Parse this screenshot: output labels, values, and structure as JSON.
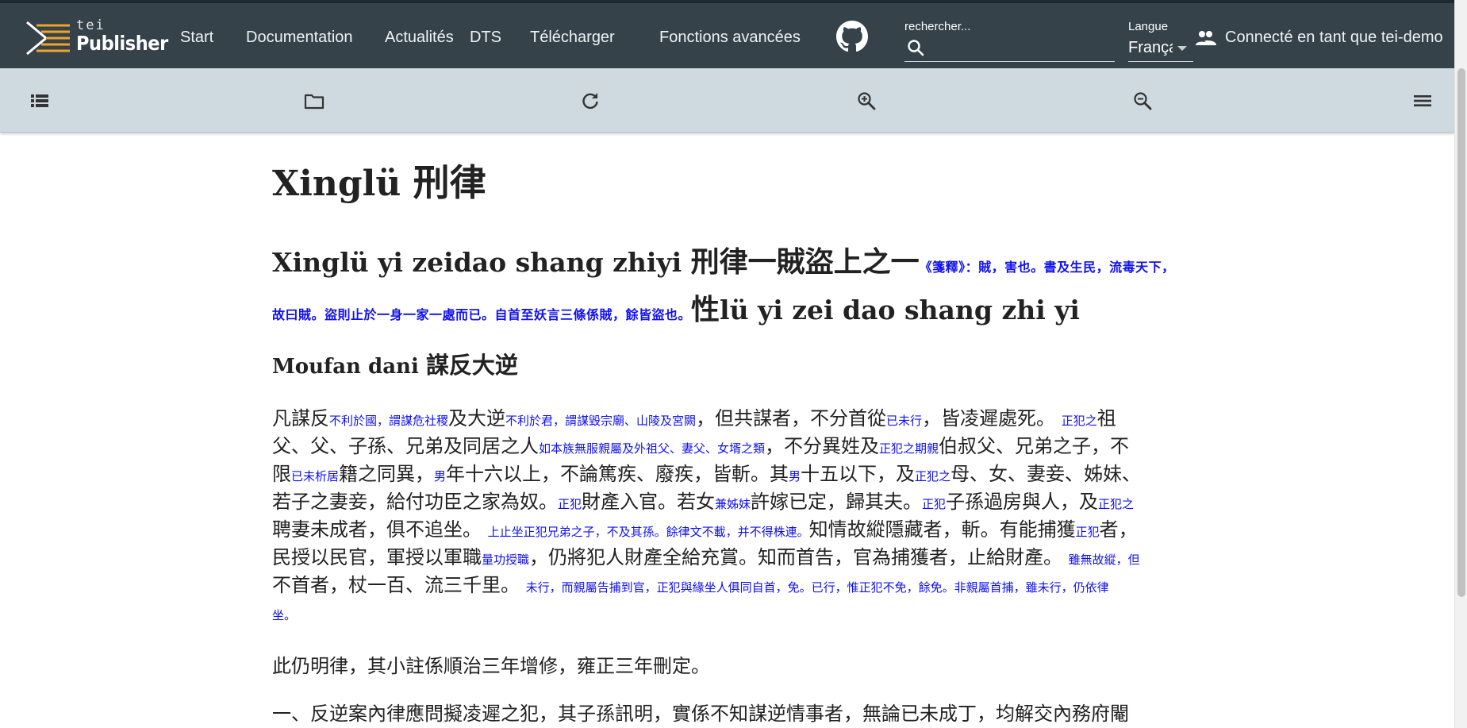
{
  "brand": {
    "tei": "tei",
    "publisher": "Publisher"
  },
  "nav": {
    "start": "Start",
    "documentation": "Documentation",
    "actualites": "Actualités",
    "dts": "DTS",
    "telecharger": "Télécharger",
    "fonctions": "Fonctions avancées"
  },
  "search": {
    "placeholder": "rechercher..."
  },
  "language": {
    "label": "Langue",
    "value": "Français"
  },
  "user": {
    "text": "Connecté en tant que tei-demo"
  },
  "toolbar": {
    "icons": [
      "toc-icon",
      "folder-icon",
      "refresh-icon",
      "zoom-in-icon",
      "zoom-out-icon",
      "menu-icon"
    ]
  },
  "document": {
    "title_latin": "Xinglü ",
    "title_cjk": "刑律",
    "section_latin": "Xinglü yi zeidao shang zhiyi ",
    "section_cjk": "刑律一賊盜上之一",
    "section_note": "《箋釋》：賊，害也。書及生民，流毒天下，故曰賊。盜則止於一身一家一處而已。自首至妖言三條係賊，餘皆盜也。",
    "section_cjk2": "性",
    "section_latin2": "lü yi zei dao shang zhi yi",
    "subsection_latin": "Moufan dani ",
    "subsection_cjk": "謀反大逆",
    "p1": {
      "l1a": "凡謀反",
      "l1n1": "不利於國，謂謀危社稷",
      "l1b": "及大逆",
      "l1n2": "不利於君，謂謀毀宗廟、山陵及宮闕",
      "l1c": "，但共謀者，不分首從",
      "l1n3": "已未行",
      "l1d": "，皆凌遲處死。",
      "l1n4": "正犯之",
      "l1e": "祖",
      "l2a": "父、父、子孫、兄弟及同居之人",
      "l2n1": "如本族無服親屬及外祖父、妻父、女壻之類",
      "l2b": "，不分異姓及",
      "l2n2": "正犯之期親",
      "l2c": "伯叔父、兄弟之子，不",
      "l3a": "限",
      "l3n1": "已未析居",
      "l3b": "籍之同異，",
      "l3n2": "男",
      "l3c": "年十六以上，不論篤疾、廢疾，皆斬。其",
      "l3n3": "男",
      "l3d": "十五以下，及",
      "l3n4": "正犯之",
      "l3e": "母、女、妻妾、姊妹、",
      "l4a": "若子之妻妾，給付功臣之家為奴。",
      "l4n1": "正犯",
      "l4b": "財產入官。若女",
      "l4n2": "兼姊妹",
      "l4c": "許嫁已定，歸其夫。",
      "l4n3": "正犯",
      "l4d": "子孫過房與人，及",
      "l4n4": "正犯之",
      "l5a": "聘妻未成者，俱不追坐。",
      "l5n1": "上止坐正犯兄弟之子，不及其孫。餘律文不載，并不得株連。",
      "l5b": "知情故縱隱藏者，斬。有能捕獲",
      "l5n2": "正犯",
      "l5c": "者，",
      "l6a": "民授以民官，軍授以軍職",
      "l6n1": "量功授職",
      "l6b": "，仍將犯人財產全給充賞。知而首告，官為捕獲者，止給財產。",
      "l6n2": "雖無故縱，但",
      "l7a": "不首者，杖一百、流三千里。",
      "l7n1": "未行，而親屬告捕到官，正犯與緣坐人俱同自首，免。已行，惟正犯不免，餘免。非親屬首捕，雖未行，仍依律",
      "l8n1": "坐。"
    },
    "p2": "此仍明律，其小註係順治三年增修，雍正三年刪定。",
    "p3": "一、反逆案內律應問擬凌遲之犯，其子孫訊明，實係不知謀逆情事者，無論已未成丁，均解交內務府閹"
  },
  "colors": {
    "header_bg": "#35424a",
    "toolbar_bg": "#cfd9e0",
    "note_blue": "#1010f0",
    "logo_orange": "#f0a32a"
  }
}
